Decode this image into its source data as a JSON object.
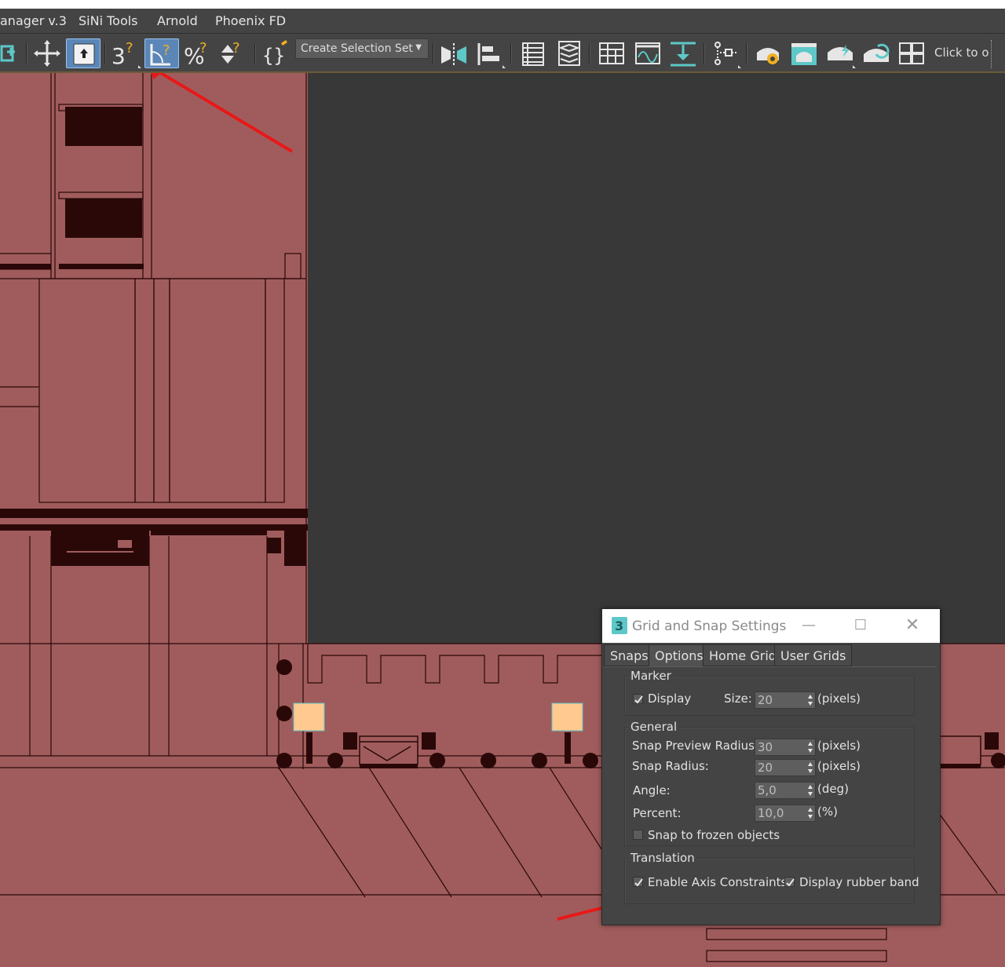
{
  "menubar": {
    "items": [
      {
        "label": "anager v.3"
      },
      {
        "label": "SiNi Tools"
      },
      {
        "label": "Arnold"
      },
      {
        "label": "Phoenix FD"
      }
    ]
  },
  "toolbar": {
    "selection_set_label": "Create Selection Set",
    "click_to_label": "Click to o",
    "icons": [
      "select-link-icon",
      "select-move-icon",
      "select-object-icon",
      "snap-3d-icon",
      "angle-snap-icon",
      "percent-snap-icon",
      "spinner-snap-icon",
      "edit-named-selection-icon",
      "mirror-icon",
      "align-icon",
      "scene-explorer-icon",
      "layer-explorer-icon",
      "ribbon-icon",
      "curve-editor-icon",
      "dope-sheet-icon",
      "schematic-view-icon",
      "render-setup-icon",
      "rendered-frame-window-icon",
      "render-production-icon",
      "render-iterative-icon",
      "render-tiles-icon"
    ]
  },
  "dialog": {
    "title": "Grid and Snap Settings",
    "tabs": [
      {
        "label": "Snaps"
      },
      {
        "label": "Options"
      },
      {
        "label": "Home Grid"
      },
      {
        "label": "User Grids"
      }
    ],
    "marker": {
      "group_label": "Marker",
      "display_label": "Display",
      "display_checked": true,
      "size_label": "Size:",
      "size_value": "20",
      "size_unit": "(pixels)"
    },
    "general": {
      "group_label": "General",
      "snap_preview_label": "Snap Preview Radius:",
      "snap_preview_value": "30",
      "snap_preview_unit": "(pixels)",
      "snap_radius_label": "Snap Radius:",
      "snap_radius_value": "20",
      "snap_radius_unit": "(pixels)",
      "angle_label": "Angle:",
      "angle_value": "5,0",
      "angle_unit": "(deg)",
      "percent_label": "Percent:",
      "percent_value": "10,0",
      "percent_unit": "(%)",
      "frozen_label": "Snap to frozen objects",
      "frozen_checked": false
    },
    "translation": {
      "group_label": "Translation",
      "axis_label": "Enable Axis Constraints",
      "axis_checked": true,
      "rubber_label": "Display rubber band",
      "rubber_checked": true
    }
  },
  "colors": {
    "viewport_fill": "#a05c5c",
    "wire": "#2a0808",
    "annotation_arrow": "#e81818",
    "active_tool": "#5a86b8"
  }
}
